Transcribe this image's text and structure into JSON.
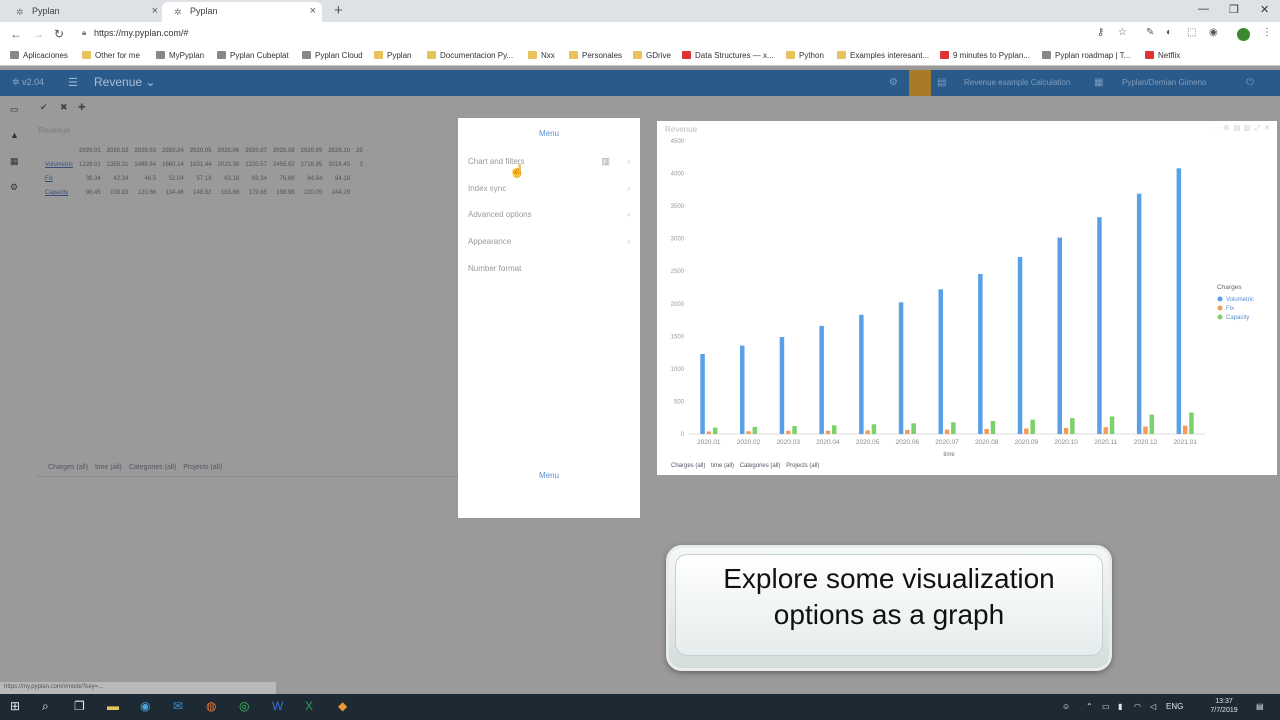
{
  "browser": {
    "tabs": [
      {
        "label": "Pyplan",
        "active": false
      },
      {
        "label": "Pyplan",
        "active": true
      }
    ],
    "url": "https://my.pyplan.com/#",
    "bookmarks": [
      "Aplicaciones",
      "Other for me",
      "MyPyplan",
      "Pyplan Cubeplat",
      "Pyplan Cloud",
      "Pyplan",
      "Documentacion Py...",
      "Nxx",
      "Personales",
      "GDrive",
      "Data Structures — x...",
      "Python",
      "Examples interesant...",
      "9 minutes to Pyplan...",
      "Pyplan roadmap | T...",
      "Netflix"
    ]
  },
  "app": {
    "version": "v2.04",
    "title": "Revenue",
    "header_right": [
      "Revenue example Calculation",
      "Pyplan/Demian Gimeno"
    ]
  },
  "table": {
    "title": "Revenue",
    "columns": [
      "2020.01",
      "2020.02",
      "2020.03",
      "2020.04",
      "2020.05",
      "2020.06",
      "2020.07",
      "2020.08",
      "2020.09",
      "2020.10",
      "20"
    ],
    "rows": [
      {
        "label": "Volumetric",
        "values": [
          "1228.01",
          "1358.31",
          "1488.84",
          "1660.14",
          "1831.44",
          "2023.38",
          "2220.57",
          "2456.62",
          "2718.85",
          "3016.45",
          "3"
        ]
      },
      {
        "label": "Fix",
        "values": [
          "38.34",
          "42.34",
          "46.5",
          "51.04",
          "57.18",
          "63.18",
          "69.34",
          "76.68",
          "84.84",
          "94.18",
          ""
        ]
      },
      {
        "label": "Capacity",
        "values": [
          "98.45",
          "108.83",
          "120.66",
          "134.46",
          "148.52",
          "163.88",
          "179.65",
          "198.98",
          "220.05",
          "244.29",
          ""
        ]
      }
    ],
    "filters": [
      "Charges (all)",
      "time (all)",
      "Categories (all)",
      "Projects (all)"
    ]
  },
  "menu": {
    "header": "Menu",
    "items": [
      "Chart and filters",
      "Index sync",
      "Advanced options",
      "Appearance",
      "Number format"
    ],
    "footer": "Menu"
  },
  "chart_panel": {
    "filters": [
      "Charges (all)",
      "time (all)",
      "Categories (all)",
      "Projects (all)"
    ]
  },
  "chart_data": {
    "type": "bar",
    "title": "Revenue",
    "xlabel": "time",
    "ylabel": "",
    "ylim": [
      0,
      4500
    ],
    "yticks": [
      0,
      500,
      1000,
      1500,
      2000,
      2500,
      3000,
      3500,
      4000,
      4500
    ],
    "categories": [
      "2020.01",
      "2020.02",
      "2020.03",
      "2020.04",
      "2020.05",
      "2020.06",
      "2020.07",
      "2020.08",
      "2020.09",
      "2020.10",
      "2020.11",
      "2020.12",
      "2021.01"
    ],
    "legend_title": "Charges",
    "legend_position": "right",
    "series": [
      {
        "name": "Volumetric",
        "color": "#5aa0e6",
        "values": [
          1228,
          1358,
          1489,
          1660,
          1831,
          2023,
          2221,
          2457,
          2719,
          3016,
          3330,
          3690,
          4080
        ]
      },
      {
        "name": "Fix",
        "color": "#f39c5a",
        "values": [
          38,
          42,
          47,
          51,
          57,
          63,
          69,
          77,
          85,
          94,
          104,
          115,
          127
        ]
      },
      {
        "name": "Capacity",
        "color": "#7ed06a",
        "values": [
          98,
          109,
          121,
          134,
          149,
          164,
          180,
          199,
          220,
          244,
          270,
          298,
          330
        ]
      }
    ]
  },
  "caption": {
    "line1": "Explore some visualization",
    "line2": "options as a graph"
  },
  "status_url": "https://my.pyplan.com/#/node?key=...",
  "taskbar": {
    "lang": "ENG",
    "time": "13:37",
    "date": "7/7/2019"
  }
}
